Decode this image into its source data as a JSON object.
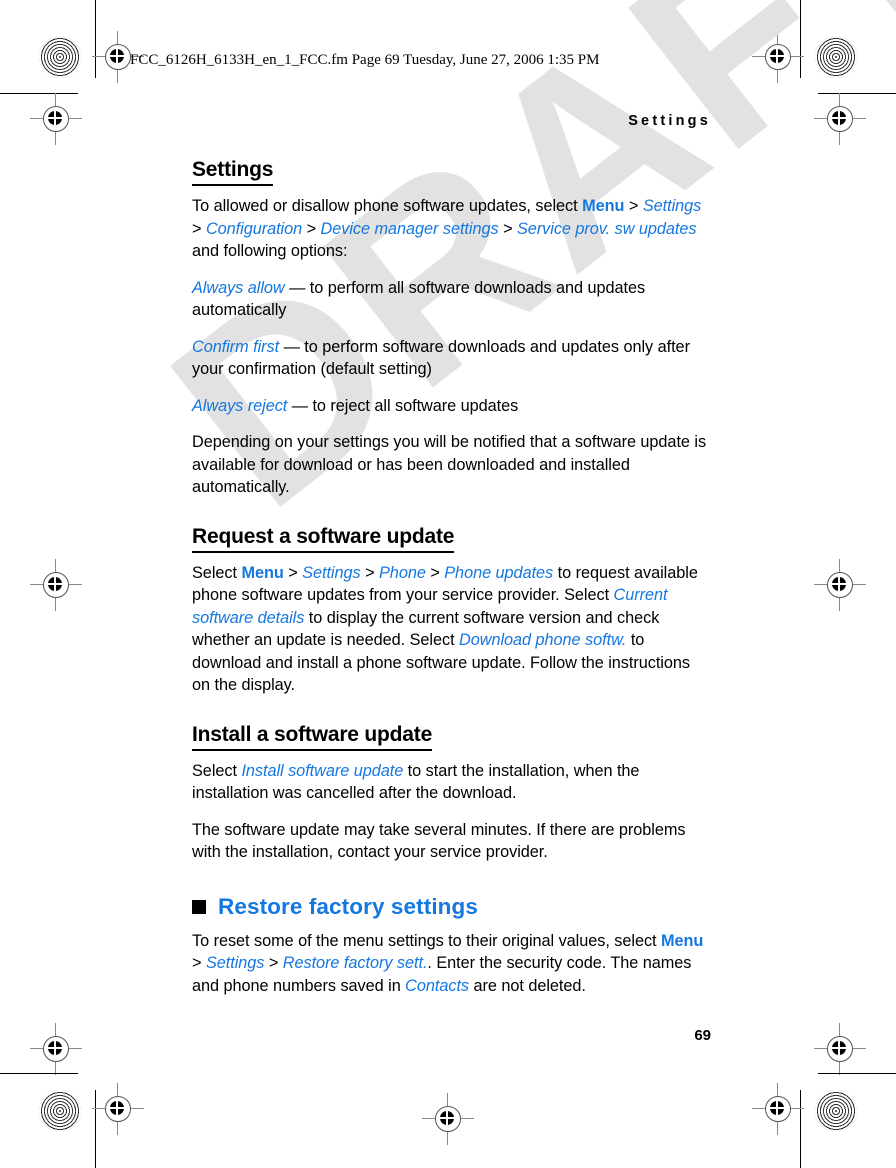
{
  "print_marks": {
    "watermark_text": "DRAFT",
    "watermark_color": "#e2e2e2"
  },
  "file_header": {
    "text": "FCC_6126H_6133H_en_1_FCC.fm  Page 69  Tuesday, June 27, 2006  1:35 PM"
  },
  "page": {
    "running_head": "Settings",
    "folio": "69",
    "accent_color": "#1577E0"
  },
  "sections": {
    "settings": {
      "heading": "Settings",
      "intro_1": "To allowed or disallow phone software updates, select ",
      "intro_menu": "Menu",
      "gt1": " > ",
      "intro_settings": "Settings",
      "gt2": " > ",
      "intro_configuration": "Configuration",
      "gt3": " > ",
      "intro_device_manager": "Device manager settings",
      "gt4": " > ",
      "intro_service_prov": "Service prov. sw updates",
      "intro_tail": " and following options:",
      "opt1_term": "Always allow",
      "opt1_desc": " — to perform all software downloads and updates automatically",
      "opt2_term": "Confirm first",
      "opt2_desc": " — to perform software downloads and updates only after your confirmation (default setting)",
      "opt3_term": "Always reject",
      "opt3_desc": " — to reject all software updates",
      "note": "Depending on your settings you will be notified that a software update is available for download or has been downloaded and installed automatically."
    },
    "request_update": {
      "heading": "Request a software update",
      "p1_a": "Select ",
      "p1_menu": "Menu",
      "p1_gt1": " > ",
      "p1_settings": "Settings",
      "p1_gt2": " > ",
      "p1_phone": "Phone",
      "p1_gt3": " > ",
      "p1_phone_updates": "Phone updates",
      "p1_b": " to request available phone software updates from your service provider. Select ",
      "p1_current": "Current software details",
      "p1_c": " to display the current software version and check whether an update is needed. Select ",
      "p1_download": "Download phone softw.",
      "p1_d": " to download and install a phone software update. Follow the instructions on the display."
    },
    "install_update": {
      "heading": "Install a software update",
      "p1_a": "Select ",
      "p1_install": "Install software update",
      "p1_b": " to start the installation, when the installation was cancelled after the download.",
      "p2": "The software update may take several minutes. If there are problems with the installation, contact your service provider."
    },
    "restore_factory": {
      "heading": "Restore factory settings",
      "p1_a": "To reset some of the menu settings to their original values, select ",
      "p1_menu": "Menu",
      "p1_gt1": " > ",
      "p1_settings": "Settings",
      "p1_gt2": " > ",
      "p1_restore": "Restore factory sett.",
      "p1_b": ". Enter the security code. The names and phone numbers saved in ",
      "p1_contacts": "Contacts",
      "p1_c": " are not deleted."
    }
  }
}
